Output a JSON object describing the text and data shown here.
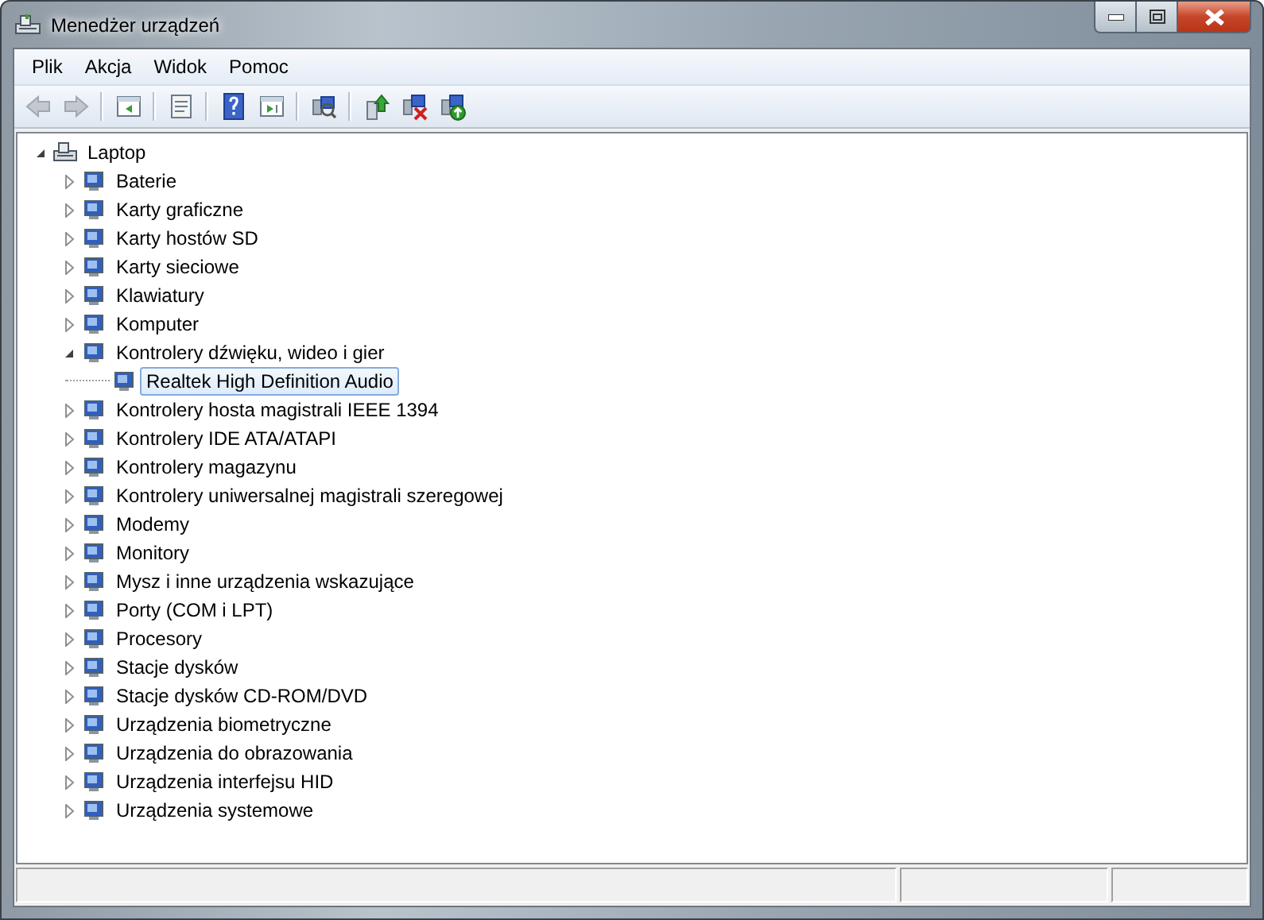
{
  "window": {
    "title": "Menedżer urządzeń"
  },
  "menu": [
    {
      "label": "Plik"
    },
    {
      "label": "Akcja"
    },
    {
      "label": "Widok"
    },
    {
      "label": "Pomoc"
    }
  ],
  "toolbar": [
    {
      "kind": "back",
      "disabled": true
    },
    {
      "kind": "forward",
      "disabled": true
    },
    {
      "kind": "separator"
    },
    {
      "kind": "tree-pane",
      "disabled": false
    },
    {
      "kind": "separator"
    },
    {
      "kind": "properties",
      "disabled": false
    },
    {
      "kind": "separator"
    },
    {
      "kind": "help",
      "disabled": false
    },
    {
      "kind": "action-pane",
      "disabled": false
    },
    {
      "kind": "separator"
    },
    {
      "kind": "scan",
      "disabled": false
    },
    {
      "kind": "separator"
    },
    {
      "kind": "update",
      "disabled": false
    },
    {
      "kind": "uninstall",
      "disabled": false
    },
    {
      "kind": "enable",
      "disabled": false
    }
  ],
  "tree": [
    {
      "label": "Laptop",
      "expanded": true,
      "selected": false,
      "children": [
        {
          "label": "Baterie",
          "expanded": false,
          "selected": false
        },
        {
          "label": "Karty graficzne",
          "expanded": false,
          "selected": false
        },
        {
          "label": "Karty hostów SD",
          "expanded": false,
          "selected": false
        },
        {
          "label": "Karty sieciowe",
          "expanded": false,
          "selected": false
        },
        {
          "label": "Klawiatury",
          "expanded": false,
          "selected": false
        },
        {
          "label": "Komputer",
          "expanded": false,
          "selected": false
        },
        {
          "label": "Kontrolery dźwięku, wideo i gier",
          "expanded": true,
          "selected": false,
          "children": [
            {
              "label": "Realtek High Definition Audio",
              "selected": true
            }
          ]
        },
        {
          "label": "Kontrolery hosta magistrali IEEE 1394",
          "expanded": false,
          "selected": false
        },
        {
          "label": "Kontrolery IDE ATA/ATAPI",
          "expanded": false,
          "selected": false
        },
        {
          "label": "Kontrolery magazynu",
          "expanded": false,
          "selected": false
        },
        {
          "label": "Kontrolery uniwersalnej magistrali szeregowej",
          "expanded": false,
          "selected": false
        },
        {
          "label": "Modemy",
          "expanded": false,
          "selected": false
        },
        {
          "label": "Monitory",
          "expanded": false,
          "selected": false
        },
        {
          "label": "Mysz i inne urządzenia wskazujące",
          "expanded": false,
          "selected": false
        },
        {
          "label": "Porty (COM i LPT)",
          "expanded": false,
          "selected": false
        },
        {
          "label": "Procesory",
          "expanded": false,
          "selected": false
        },
        {
          "label": "Stacje dysków",
          "expanded": false,
          "selected": false
        },
        {
          "label": "Stacje dysków CD-ROM/DVD",
          "expanded": false,
          "selected": false
        },
        {
          "label": "Urządzenia biometryczne",
          "expanded": false,
          "selected": false
        },
        {
          "label": "Urządzenia do obrazowania",
          "expanded": false,
          "selected": false
        },
        {
          "label": "Urządzenia interfejsu HID",
          "expanded": false,
          "selected": false
        },
        {
          "label": "Urządzenia systemowe",
          "expanded": false,
          "selected": false
        }
      ]
    }
  ]
}
